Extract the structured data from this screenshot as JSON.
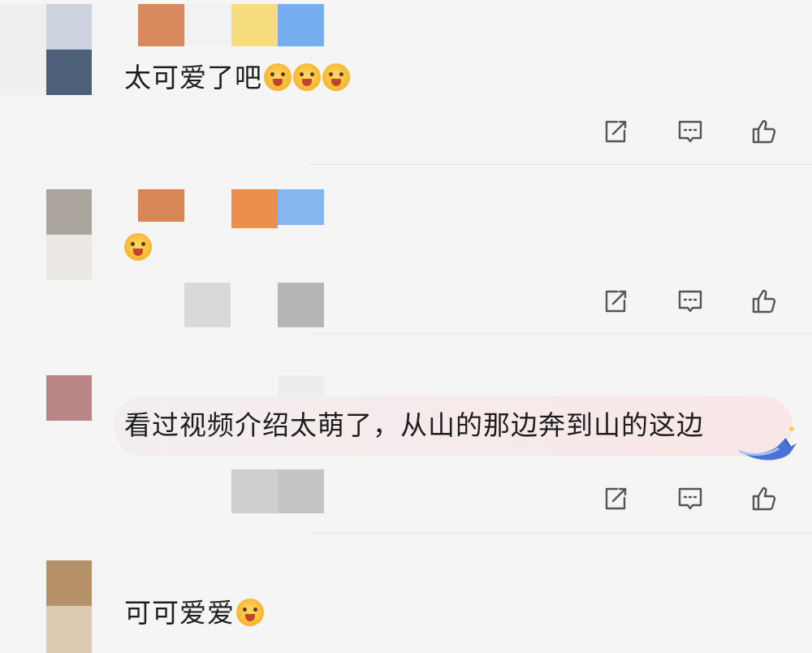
{
  "comments": [
    {
      "text": "太可爱了吧",
      "emoji_count": 3,
      "emoji_name": "blush-emoji"
    },
    {
      "text": "",
      "emoji_count": 1,
      "emoji_name": "blush-emoji"
    },
    {
      "text": "看过视频介绍太萌了，从山的那边奔到山的这边",
      "emoji_count": 0,
      "emoji_name": ""
    },
    {
      "text": "可可爱爱",
      "emoji_count": 1,
      "emoji_name": "drooling-emoji"
    }
  ],
  "actions": [
    "share-icon",
    "reply-icon",
    "like-icon"
  ],
  "colors": {
    "icon": "#555555",
    "divider": "#e4e4e4",
    "highlight": "#f7e9ea"
  }
}
